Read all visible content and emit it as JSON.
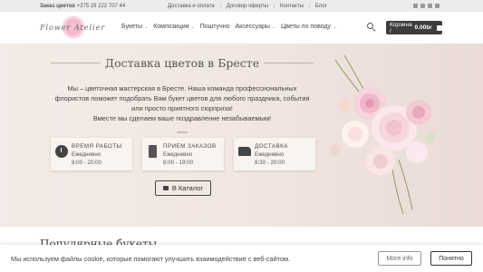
{
  "topbar": {
    "phone_label": "Заказ цветов",
    "phone": "+375 29 222 707 44",
    "links": [
      "Доставка и оплата",
      "Договор оферты",
      "Контакты",
      "Блог"
    ]
  },
  "header": {
    "logo_text": "Flower Atelier",
    "nav": [
      {
        "label": "Букеты",
        "dropdown": true
      },
      {
        "label": "Композиции",
        "dropdown": true
      },
      {
        "label": "Поштучно",
        "dropdown": false
      },
      {
        "label": "Аксессуары",
        "dropdown": true
      },
      {
        "label": "Цветы по поводу",
        "dropdown": true
      }
    ],
    "cart_label": "Корзина /",
    "cart_total": "0.00br"
  },
  "hero": {
    "title": "Доставка цветов в Бресте",
    "description": "Мы – цветочная мастерская в Бресте. Наша команда профессиональных флористов поможет подобрать Вам букет цветов для любого праздника, события или просто приятного сюрприза!",
    "tagline": "Вместе мы сделаем ваше поздравление незабываемым!",
    "cards": [
      {
        "label": "ВРЕМЯ РАБОТЫ",
        "line1": "Ежедневно",
        "line2": "8:00 - 20:00"
      },
      {
        "label": "ПРИЕМ ЗАКАЗОВ",
        "line1": "Ежедневно",
        "line2": "8:00 - 19:00"
      },
      {
        "label": "ДОСТАВКА",
        "line1": "Ежедневно",
        "line2": "8:30 - 20:00"
      }
    ],
    "catalog_button": "В Каталог"
  },
  "section": {
    "title": "Популярные букеты"
  },
  "cookie": {
    "message": "Мы используем файлы cookie, которые помогают улучшить взаимодействие с веб-сайтом.",
    "more_info": "More info",
    "accept": "Понятно"
  }
}
